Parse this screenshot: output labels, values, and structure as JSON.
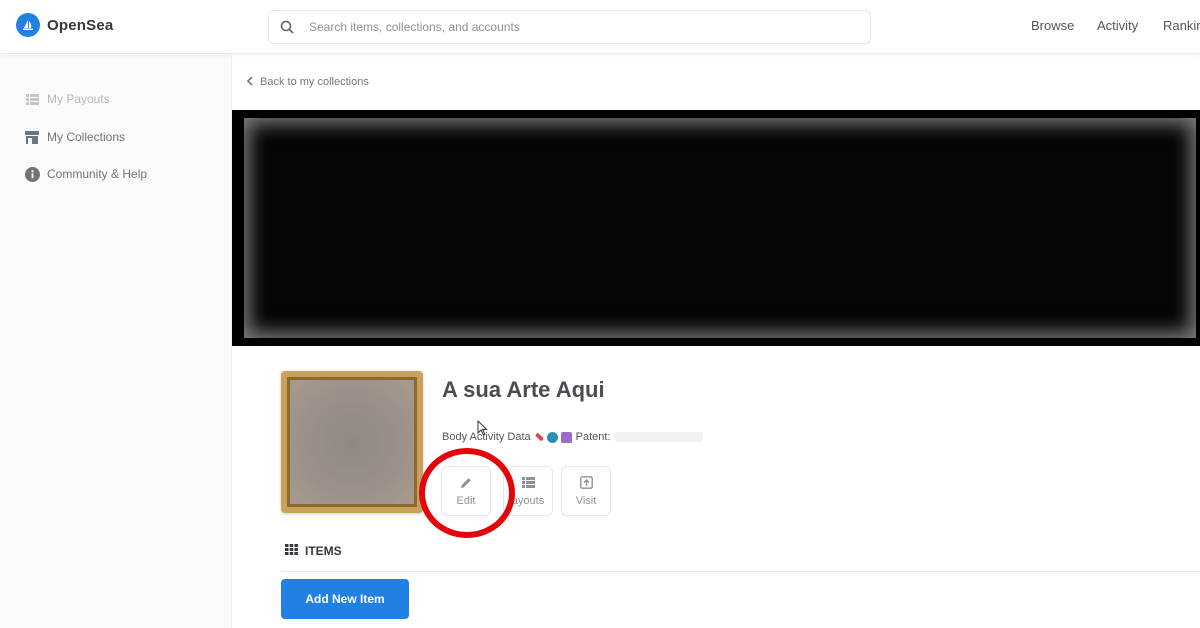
{
  "header": {
    "brand": "OpenSea",
    "search_placeholder": "Search items, collections, and accounts",
    "nav": [
      "Browse",
      "Activity",
      "Rankin"
    ]
  },
  "sidebar": {
    "items": [
      {
        "label": "My Payouts",
        "icon": "list-icon",
        "dimmed": true
      },
      {
        "label": "My Collections",
        "icon": "storefront-icon"
      },
      {
        "label": "Community & Help",
        "icon": "info-icon"
      }
    ]
  },
  "main": {
    "back_link": "Back to my collections",
    "collection": {
      "title": "A sua Arte Aqui",
      "description_prefix": "Body Activity Data",
      "description_suffix": "Patent:"
    },
    "actions": {
      "edit": "Edit",
      "payouts": "ayouts",
      "visit": "Visit"
    },
    "items_heading": "ITEMS",
    "add_button": "Add New Item"
  },
  "colors": {
    "accent": "#2081e2",
    "annotation_circle": "#e3050b"
  }
}
